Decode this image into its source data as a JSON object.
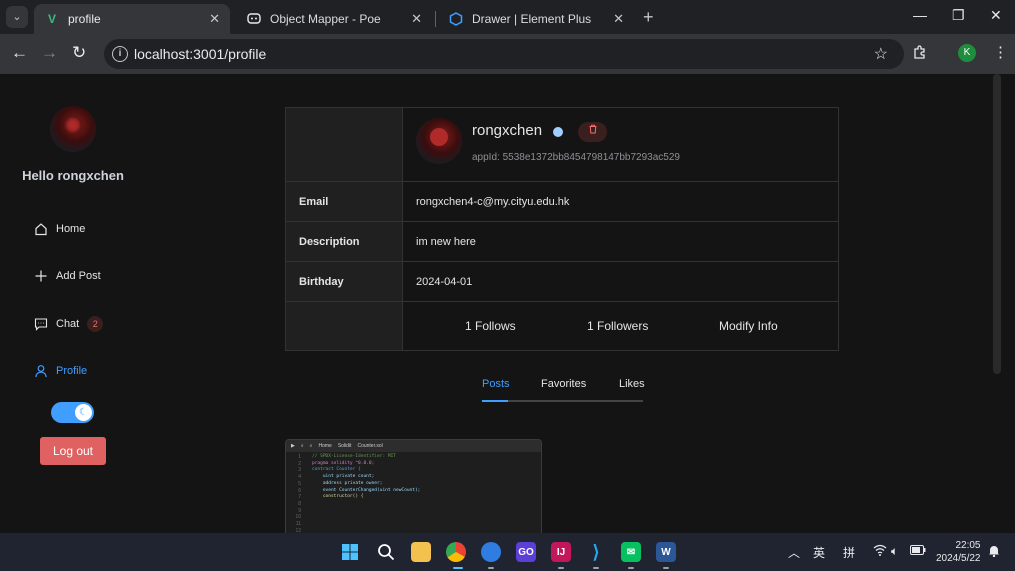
{
  "browser": {
    "tabs": [
      {
        "title": "profile",
        "favicon": "V",
        "active": true
      },
      {
        "title": "Object Mapper - Poe",
        "favicon": "poe",
        "active": false
      },
      {
        "title": "Drawer | Element Plus",
        "favicon": "element",
        "active": false
      }
    ],
    "url": "localhost:3001/profile",
    "profile_initial": "K"
  },
  "sidebar": {
    "greeting": "Hello rongxchen",
    "items": [
      {
        "label": "Home",
        "icon": "home-icon"
      },
      {
        "label": "Add Post",
        "icon": "plus-icon"
      },
      {
        "label": "Chat",
        "icon": "chat-icon",
        "badge": "2"
      },
      {
        "label": "Profile",
        "icon": "user-icon",
        "active": true
      }
    ],
    "logout_label": "Log out"
  },
  "profile": {
    "username": "rongxchen",
    "app_id": "appId: 5538e1372bb8454798147bb7293ac529",
    "fields": [
      {
        "label": "Email",
        "value": "rongxchen4-c@my.cityu.edu.hk"
      },
      {
        "label": "Description",
        "value": "im new here"
      },
      {
        "label": "Birthday",
        "value": "2024-04-01"
      }
    ],
    "follows": "1 Follows",
    "followers": "1 Followers",
    "modify_label": "Modify Info"
  },
  "tabs": [
    {
      "label": "Posts",
      "active": true
    },
    {
      "label": "Favorites",
      "active": false
    },
    {
      "label": "Likes",
      "active": false
    }
  ],
  "post_preview": {
    "toolbar": [
      "Home",
      "Solidit",
      "Counter.sol"
    ],
    "lines": [
      "// SPDX-License-Identifier: MIT",
      "pragma solidity ^0.8.0;",
      "",
      "contract Counter {",
      "",
      "    uint private count;",
      "",
      "    address private owner;",
      "",
      "    event CounterChanged(uint newCount);",
      "",
      "    constructor() {"
    ]
  },
  "taskbar": {
    "tray_lang_1": "英",
    "tray_lang_2": "拼",
    "time": "22:05",
    "date": "2024/5/22"
  },
  "colors": {
    "accent": "#409eff",
    "danger": "#e06161",
    "background": "#141414"
  }
}
